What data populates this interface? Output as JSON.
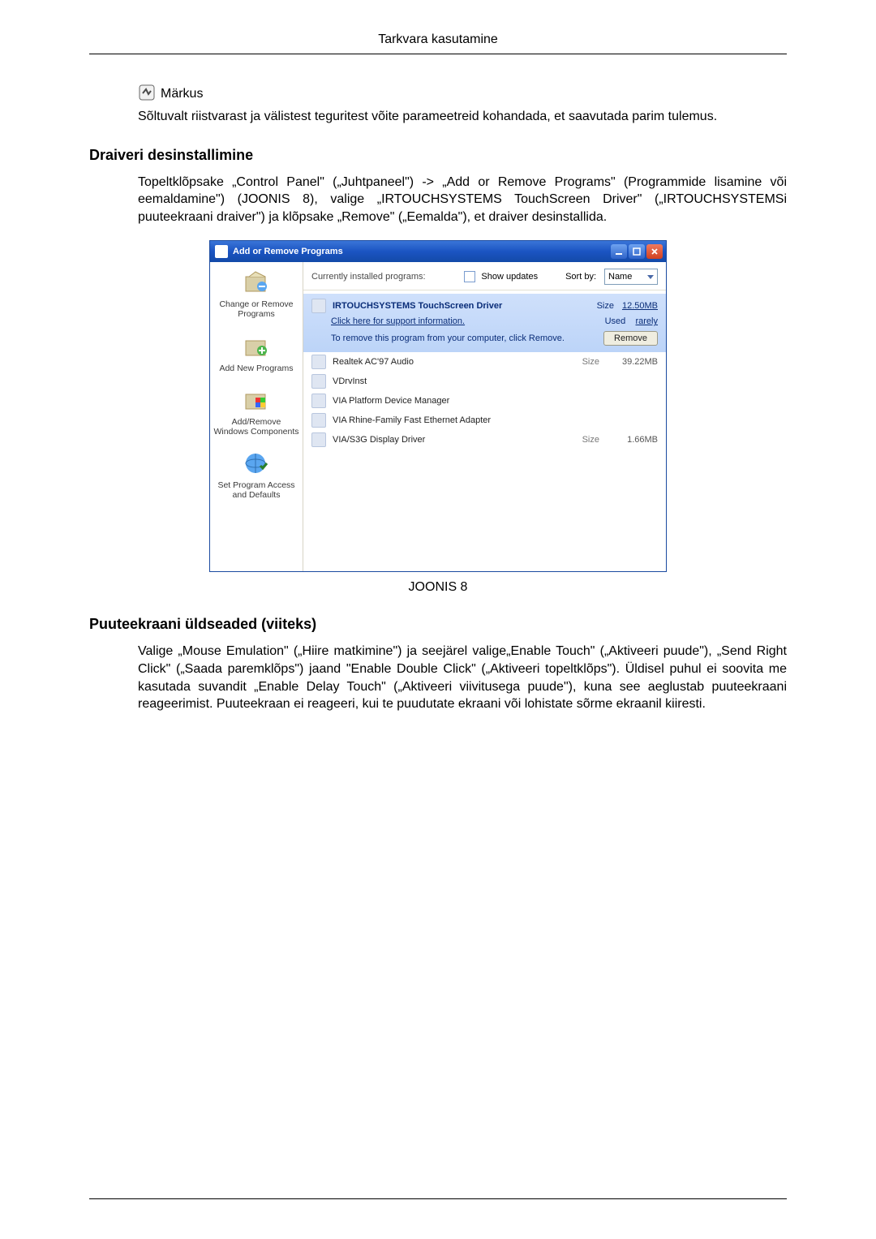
{
  "header": {
    "title": "Tarkvara kasutamine"
  },
  "note": {
    "label": "Märkus"
  },
  "note_body": "Sõltuvalt riistvarast ja välistest teguritest võite parameetreid kohandada, et saavutada parim tulemus.",
  "section1": {
    "heading": "Draiveri desinstallimine",
    "body": "Topeltklõpsake „Control Panel\" („Juhtpaneel\") -> „Add or Remove Programs\" (Programmide lisamine või eemaldamine\") (JOONIS 8), valige „IRTOUCHSYSTEMS TouchScreen Driver\" („IRTOUCHSYSTEMSi puuteekraani draiver\") ja klõpsake „Remove\" („Eemalda\"), et draiver desinstallida."
  },
  "screenshot": {
    "window_title": "Add or Remove Programs",
    "toolbar": {
      "installed_label": "Currently installed programs:",
      "show_updates": "Show updates",
      "sort_by_label": "Sort by:",
      "sort_value": "Name"
    },
    "sidebar": [
      {
        "label": "Change or Remove Programs"
      },
      {
        "label": "Add New Programs"
      },
      {
        "label": "Add/Remove Windows Components"
      },
      {
        "label": "Set Program Access and Defaults"
      }
    ],
    "selected": {
      "name": "IRTOUCHSYSTEMS TouchScreen Driver",
      "size_label": "Size",
      "size": "12.50MB",
      "support": "Click here for support information.",
      "used_label": "Used",
      "used": "rarely",
      "remove_hint": "To remove this program from your computer, click Remove.",
      "remove_btn": "Remove"
    },
    "programs": [
      {
        "name": "Realtek AC'97 Audio",
        "size_label": "Size",
        "size": "39.22MB"
      },
      {
        "name": "VDrvInst",
        "size_label": "",
        "size": ""
      },
      {
        "name": "VIA Platform Device Manager",
        "size_label": "",
        "size": ""
      },
      {
        "name": "VIA Rhine-Family Fast Ethernet Adapter",
        "size_label": "",
        "size": ""
      },
      {
        "name": "VIA/S3G Display Driver",
        "size_label": "Size",
        "size": "1.66MB"
      }
    ]
  },
  "figure_caption": "JOONIS 8",
  "section2": {
    "heading": "Puuteekraani üldseaded (viiteks)",
    "body": "Valige „Mouse Emulation\" („Hiire matkimine\") ja seejärel valige„Enable Touch\" („Aktiveeri puude\"), „Send Right Click\" („Saada paremklõps\") jaand \"Enable Double Click\" („Aktiveeri topeltklõps\"). Üldisel puhul ei soovita me kasutada suvandit „Enable Delay Touch\" („Aktiveeri viivitusega puude\"), kuna see aeglustab puuteekraani reageerimist. Puuteekraan ei reageeri, kui te puudutate ekraani või lohistate sõrme ekraanil kiiresti."
  }
}
